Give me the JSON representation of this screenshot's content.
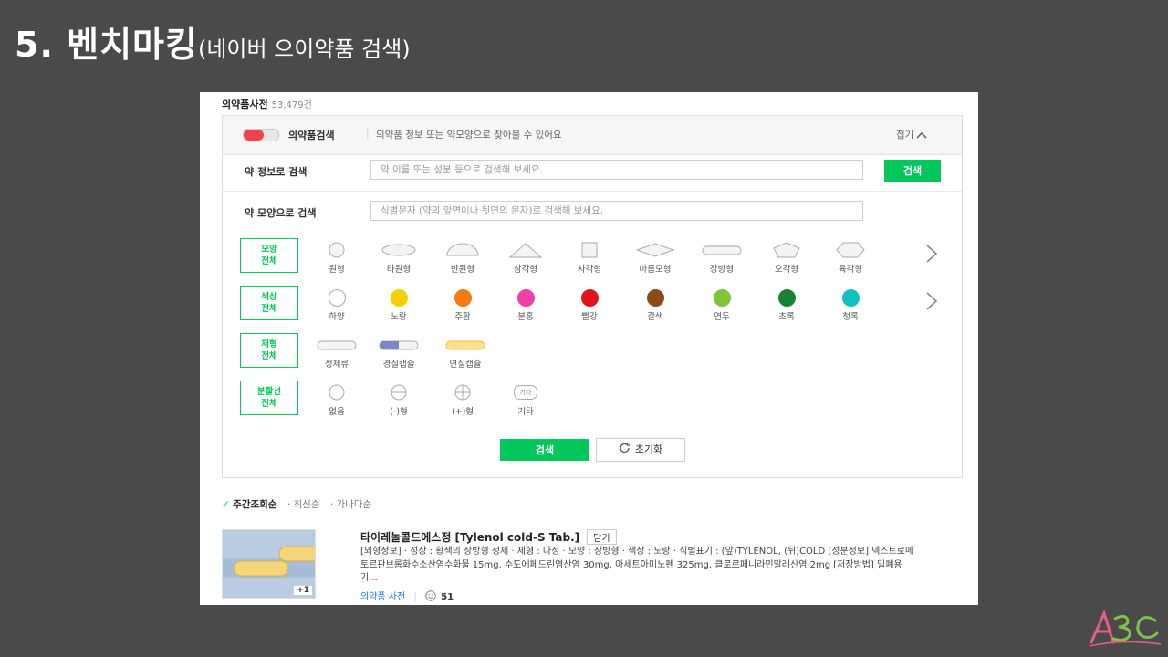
{
  "slide": {
    "title_big": "5. 벤치마킹",
    "title_small": "(네이버 으이약품 검색)"
  },
  "dictionary": {
    "title": "의약품사전",
    "count": "53,479건"
  },
  "search_box": {
    "toggle_label": "의약품검색",
    "separator": "|",
    "description": "의약품 정보 또는 약모양으로 찾아볼 수 있어요",
    "fold_label": "접기",
    "info_label": "약 정보로 검색",
    "info_placeholder": "약 이름 또는 성분 등으로 검색해 보세요.",
    "info_button": "검색",
    "shape_label": "약 모양으로 검색",
    "shape_placeholder": "식별문자 (약의 앞면이나 뒷면의 문자)로 검색해 보세요."
  },
  "filters": {
    "shape": {
      "button": [
        "모양",
        "전체"
      ],
      "options": [
        {
          "label": "원형",
          "icon": "circle-shape-icon"
        },
        {
          "label": "타원형",
          "icon": "oval-shape-icon"
        },
        {
          "label": "반원형",
          "icon": "semicircle-shape-icon"
        },
        {
          "label": "삼각형",
          "icon": "triangle-shape-icon"
        },
        {
          "label": "사각형",
          "icon": "square-shape-icon"
        },
        {
          "label": "마름모형",
          "icon": "diamond-shape-icon"
        },
        {
          "label": "장방형",
          "icon": "oblong-shape-icon"
        },
        {
          "label": "오각형",
          "icon": "pentagon-shape-icon"
        },
        {
          "label": "육각형",
          "icon": "hexagon-shape-icon"
        }
      ]
    },
    "color": {
      "button": [
        "색상",
        "전체"
      ],
      "options": [
        {
          "label": "하양",
          "color": "#ffffff"
        },
        {
          "label": "노랑",
          "color": "#f5cf00"
        },
        {
          "label": "주황",
          "color": "#f57a10"
        },
        {
          "label": "분홍",
          "color": "#f03fa6"
        },
        {
          "label": "빨강",
          "color": "#e0141b"
        },
        {
          "label": "갈색",
          "color": "#8b4a1a"
        },
        {
          "label": "연두",
          "color": "#7ec636"
        },
        {
          "label": "초록",
          "color": "#178235"
        },
        {
          "label": "청록",
          "color": "#14c0c0"
        }
      ]
    },
    "form": {
      "button": [
        "제형",
        "전체"
      ],
      "options": [
        {
          "label": "정제류",
          "icon": "tablet-form-icon"
        },
        {
          "label": "경질캡슐",
          "icon": "hard-capsule-icon"
        },
        {
          "label": "연질캡슐",
          "icon": "soft-capsule-icon"
        }
      ]
    },
    "line": {
      "button": [
        "분할선",
        "전체"
      ],
      "options": [
        {
          "label": "없음",
          "icon": "no-line-icon"
        },
        {
          "label": "(-)형",
          "icon": "minus-line-icon"
        },
        {
          "label": "(+)형",
          "icon": "plus-line-icon"
        },
        {
          "label": "기타",
          "icon": "other-line-icon",
          "glyph": "기타"
        }
      ]
    }
  },
  "actions": {
    "search": "검색",
    "reset": "초기화"
  },
  "sort": {
    "active": "주간조회순",
    "others": [
      "최신순",
      "가나다순"
    ]
  },
  "result": {
    "title": "타이레놀콜드에스정 [Tylenol cold-S Tab.]",
    "tag": "닫기",
    "thumb_badge": "+1",
    "description": "[외형정보] · 성상 : 황색의 장방형 정제 · 제형 : 나정 · 모양 : 장방형 · 색상 : 노랑 · 식별표기 : (앞)TYLENOL, (뒤)COLD [성분정보] 덱스트로메토르판브롬화수소산염수화물 15mg, 수도에페드린염산염 30mg, 아세트아미노펜 325mg, 클로르페니라민말레산염 2mg [저장방법] 밀폐용기...",
    "source": "의약품 사전",
    "count": "51"
  },
  "colors": {
    "accent": "#03c75a",
    "toggle": "#f0444a",
    "background": "#4a4a4a"
  }
}
